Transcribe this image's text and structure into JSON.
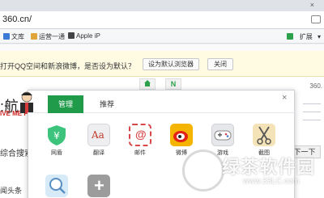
{
  "browser": {
    "tab_close": "×",
    "address": "360.cn/",
    "bookmarks": [
      {
        "label": "文库",
        "icon": "doc-icon",
        "color": "#3a7bd5"
      },
      {
        "label": "运营一通",
        "icon": "folder-icon",
        "color": "#e0a53a"
      },
      {
        "label": "Apple iP",
        "icon": "apple-icon",
        "color": "#444444"
      }
    ],
    "toolbar_right": {
      "expand": "扩展",
      "menu": "▾"
    }
  },
  "infobar": {
    "text": "打开QQ空间和新浪微博，是否设为默认？",
    "set_default_button": "设为默认浏览器",
    "close_button": "关闭"
  },
  "page": {
    "nav_title": ":航",
    "banner": "IVE ME FI",
    "search_label": "综合搜索",
    "news_label": "闻头条",
    "next_button": "下一下",
    "right_num": "360.",
    "mini_tabs": [
      "",
      "N"
    ]
  },
  "popup": {
    "tabs": [
      {
        "label": "管理",
        "active": true
      },
      {
        "label": "推荐",
        "active": false
      }
    ],
    "close": "×",
    "apps": [
      {
        "label": "网盾",
        "icon": "shield-icon",
        "color": "#3cc47c",
        "glyph": "¥"
      },
      {
        "label": "翻译",
        "icon": "translate-icon",
        "color": "#e9e9ec",
        "glyph": "Aa"
      },
      {
        "label": "邮件",
        "icon": "mail-icon",
        "color": "#ffffff",
        "glyph": "@"
      },
      {
        "label": "微博",
        "icon": "weibo-icon",
        "color": "#f0b400",
        "glyph": "◉"
      },
      {
        "label": "游戏",
        "icon": "gamepad-icon",
        "color": "#e5e6e8",
        "glyph": "◌"
      },
      {
        "label": "截图",
        "icon": "scissors-icon",
        "color": "#f2e1b4",
        "glyph": "✂"
      }
    ],
    "bottom_apps": [
      {
        "label": "",
        "icon": "magnifier-icon",
        "color": "#d5e8f7",
        "glyph": "⌕"
      },
      {
        "label": "",
        "icon": "add-icon",
        "color": "#9a9a9a",
        "glyph": "+"
      }
    ]
  },
  "watermark": {
    "title": "绿茶软件园",
    "url": "www.33LC.com"
  }
}
